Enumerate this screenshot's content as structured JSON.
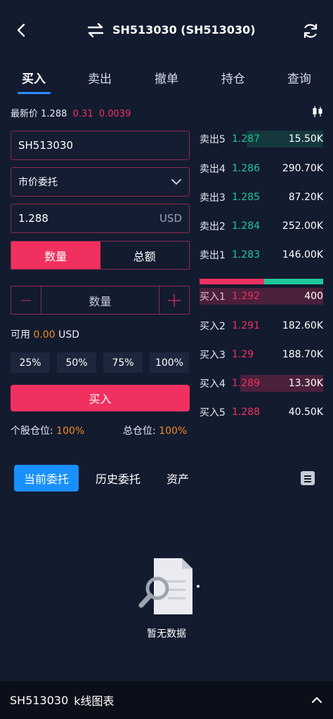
{
  "header": {
    "title": "SH513030 (SH513030)",
    "icons": [
      "chevron-left-icon",
      "swap-icon",
      "refresh-icon"
    ]
  },
  "tabs": [
    {
      "label": "买入",
      "active": true
    },
    {
      "label": "卖出",
      "active": false
    },
    {
      "label": "撤单",
      "active": false
    },
    {
      "label": "持仓",
      "active": false
    },
    {
      "label": "查询",
      "active": false
    }
  ],
  "price": {
    "label": "最新价",
    "value": "1.288",
    "change": "0.31",
    "change_pct": "0.0039"
  },
  "form": {
    "symbol": "SH513030",
    "order_type": "市价委托",
    "price_value": "1.288",
    "price_unit": "USD",
    "mode_quantity": "数量",
    "mode_amount": "总额",
    "quantity_placeholder": "数量",
    "available_label": "可用",
    "available_value": "0.00",
    "available_unit": "USD",
    "percents": [
      "25%",
      "50%",
      "75%",
      "100%"
    ],
    "buy_button": "买入",
    "stock_position_label": "个股仓位:",
    "stock_position_value": "100%",
    "total_position_label": "总仓位:",
    "total_position_value": "100%"
  },
  "order_book": {
    "sell": [
      {
        "label": "卖出5",
        "price": "1.287",
        "volume": "15.50K",
        "depth": 0.62
      },
      {
        "label": "卖出4",
        "price": "1.286",
        "volume": "290.70K",
        "depth": 0
      },
      {
        "label": "卖出3",
        "price": "1.285",
        "volume": "87.20K",
        "depth": 0
      },
      {
        "label": "卖出2",
        "price": "1.284",
        "volume": "252.00K",
        "depth": 0
      },
      {
        "label": "卖出1",
        "price": "1.283",
        "volume": "146.00K",
        "depth": 0
      }
    ],
    "buy_sell_ratio": 0.52,
    "buy": [
      {
        "label": "买入1",
        "price": "1.292",
        "volume": "400",
        "depth": 1.0
      },
      {
        "label": "买入2",
        "price": "1.291",
        "volume": "182.60K",
        "depth": 0
      },
      {
        "label": "买入3",
        "price": "1.29",
        "volume": "188.70K",
        "depth": 0
      },
      {
        "label": "买入4",
        "price": "1.289",
        "volume": "13.30K",
        "depth": 0.67
      },
      {
        "label": "买入5",
        "price": "1.288",
        "volume": "40.50K",
        "depth": 0
      }
    ]
  },
  "orders_tabs": [
    {
      "label": "当前委托",
      "active": true
    },
    {
      "label": "历史委托",
      "active": false
    },
    {
      "label": "资产",
      "active": false
    }
  ],
  "empty_text": "暂无数据",
  "footer": {
    "symbol": "SH513030",
    "label": "k线图表"
  },
  "colors": {
    "background": "#131b2f",
    "accent_red": "#f0315f",
    "accent_green": "#1ec999",
    "accent_blue": "#1890ff",
    "accent_orange": "#f08a24"
  }
}
